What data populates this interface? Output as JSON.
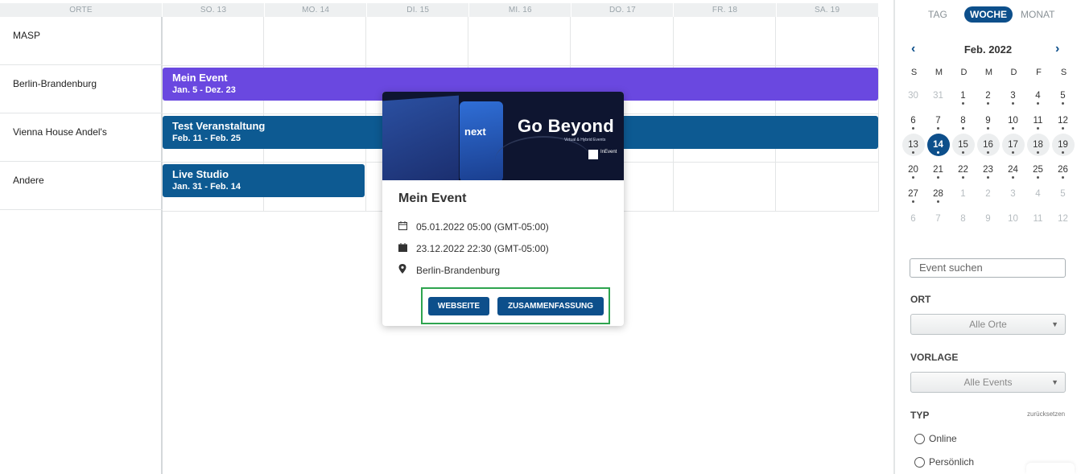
{
  "header": {
    "places_label": "ORTE",
    "days": [
      "SO. 13",
      "MO. 14",
      "DI. 15",
      "MI. 16",
      "DO. 17",
      "FR. 18",
      "SA. 19"
    ]
  },
  "locations": [
    "MASP",
    "Berlin-Brandenburg",
    "Vienna House Andel's",
    "Andere"
  ],
  "events": [
    {
      "title": "Mein Event",
      "dates": "Jan. 5 - Dez. 23",
      "color": "#6a48e0"
    },
    {
      "title": "Test Veranstaltung",
      "dates": "Feb. 11 - Feb. 25",
      "color": "#0d5a92"
    },
    {
      "title": "Live Studio",
      "dates": "Jan. 31 - Feb. 14",
      "color": "#0d5a92"
    }
  ],
  "popup": {
    "banner_text": "Go Beyond",
    "banner_sub": "Virtual & Hybrid Events",
    "banner_next": "next",
    "banner_logo": "InEvent",
    "title": "Mein Event",
    "start": "05.01.2022 05:00 (GMT-05:00)",
    "end": "23.12.2022 22:30 (GMT-05:00)",
    "location": "Berlin-Brandenburg",
    "btn_website": "WEBSEITE",
    "btn_summary": "ZUSAMMENFASSUNG",
    "highlight_color": "#2ea44f"
  },
  "views": {
    "day": "TAG",
    "week": "WOCHE",
    "month": "MONAT",
    "active": "WOCHE"
  },
  "calendar": {
    "month_label": "Feb. 2022",
    "prev_icon": "chevron-left-icon",
    "next_icon": "chevron-right-icon",
    "weekdays": [
      "S",
      "M",
      "D",
      "M",
      "D",
      "F",
      "S"
    ],
    "weeks": [
      [
        "30",
        "31",
        "1",
        "2",
        "3",
        "4",
        "5"
      ],
      [
        "6",
        "7",
        "8",
        "9",
        "10",
        "11",
        "12"
      ],
      [
        "13",
        "14",
        "15",
        "16",
        "17",
        "18",
        "19"
      ],
      [
        "20",
        "21",
        "22",
        "23",
        "24",
        "25",
        "26"
      ],
      [
        "27",
        "28",
        "1",
        "2",
        "3",
        "4",
        "5"
      ],
      [
        "6",
        "7",
        "8",
        "9",
        "10",
        "11",
        "12"
      ]
    ],
    "today": "14"
  },
  "filters": {
    "search_placeholder": "Event suchen",
    "place_label": "ORT",
    "place_value": "Alle Orte",
    "template_label": "VORLAGE",
    "template_value": "Alle Events",
    "type_label": "TYP",
    "reset_label": "zurücksetzen",
    "type_options": [
      "Online",
      "Persönlich"
    ]
  },
  "colors": {
    "accent": "#0d4f8b",
    "event_purple": "#6a48e0",
    "event_blue": "#0d5a92"
  }
}
